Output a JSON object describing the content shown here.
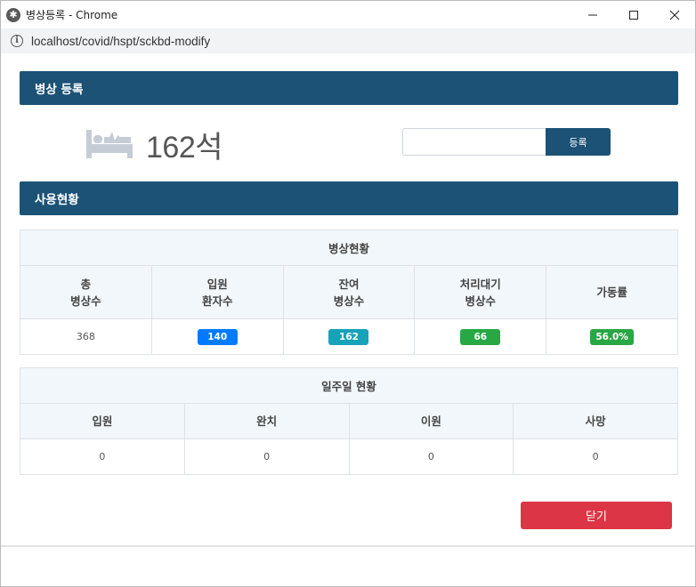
{
  "window": {
    "title": "병상등록 - Chrome",
    "url": "localhost/covid/hspt/sckbd-modify",
    "app_icon": "gear-icon"
  },
  "register_section": {
    "header": "병상 등록",
    "count_text": "162석",
    "input_value": "",
    "button_label": "등록"
  },
  "usage_section": {
    "header": "사용현황",
    "bed_status": {
      "caption": "병상현황",
      "columns": [
        {
          "line1": "총",
          "line2": "병상수"
        },
        {
          "line1": "입원",
          "line2": "환자수"
        },
        {
          "line1": "잔여",
          "line2": "병상수"
        },
        {
          "line1": "처리대기",
          "line2": "병상수"
        },
        {
          "line1": "가동률",
          "line2": ""
        }
      ],
      "values": {
        "total": "368",
        "admitted": "140",
        "remaining": "162",
        "pending": "66",
        "utilization": "56.0%"
      }
    },
    "weekly_status": {
      "caption": "일주일 현황",
      "columns": [
        "입원",
        "완치",
        "이원",
        "사망"
      ],
      "values": [
        "0",
        "0",
        "0",
        "0"
      ]
    }
  },
  "footer": {
    "close_label": "닫기"
  },
  "colors": {
    "primary": "#1c5276",
    "badge_blue": "#007bff",
    "badge_teal": "#17a2b8",
    "badge_green": "#28a745",
    "danger": "#dc3545"
  }
}
